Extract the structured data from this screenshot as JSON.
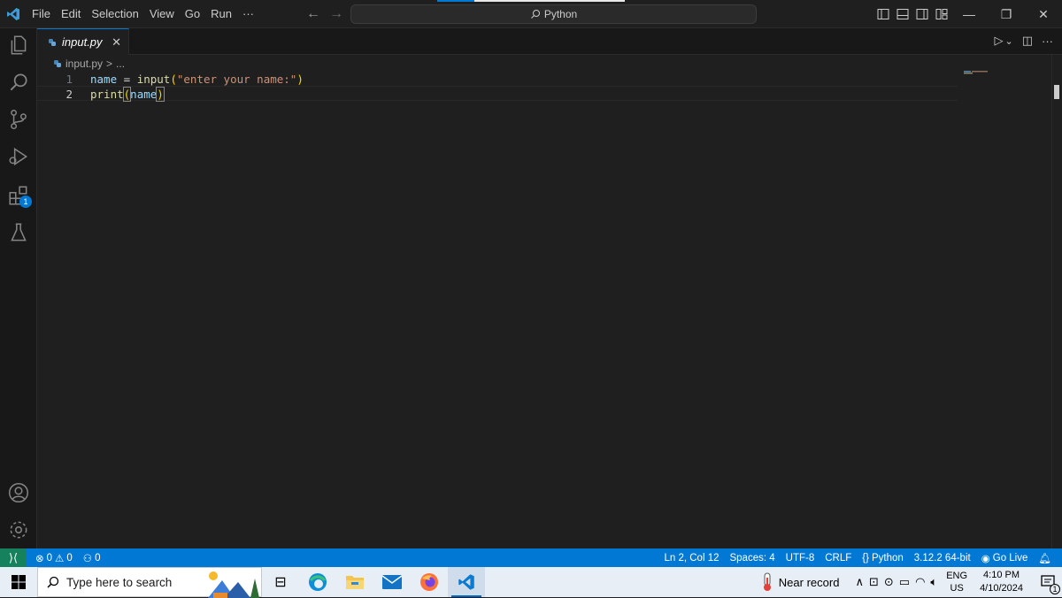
{
  "titlebar": {
    "menu": [
      "File",
      "Edit",
      "Selection",
      "View",
      "Go",
      "Run",
      "···"
    ],
    "command_center": "Python",
    "window_controls": {
      "minimize": "—",
      "restore": "❐",
      "close": "✕"
    }
  },
  "activity_bar": {
    "items": [
      "explorer-icon",
      "search-icon",
      "source-control-icon",
      "run-debug-icon",
      "extensions-icon",
      "testing-icon"
    ],
    "extensions_badge": "1",
    "bottom": [
      "accounts-icon",
      "manage-gear-icon"
    ]
  },
  "tabs": [
    {
      "label": "input.py",
      "close": "✕"
    }
  ],
  "editor_actions": {
    "run": "▷",
    "dropdown": "⌄",
    "split": "◫",
    "more": "···"
  },
  "breadcrumb": {
    "file": "input.py",
    "separator": ">",
    "rest": "..."
  },
  "editor": {
    "lines": [
      {
        "number": "1",
        "tokens": [
          {
            "text": "name",
            "type": "var"
          },
          {
            "text": " = ",
            "type": "op"
          },
          {
            "text": "input",
            "type": "fn"
          },
          {
            "text": "(",
            "type": "par"
          },
          {
            "text": "\"enter your name:\"",
            "type": "str"
          },
          {
            "text": ")",
            "type": "par"
          }
        ]
      },
      {
        "number": "2",
        "tokens": [
          {
            "text": "print",
            "type": "fn"
          },
          {
            "text": "(",
            "type": "par"
          },
          {
            "text": "name",
            "type": "var"
          },
          {
            "text": ")",
            "type": "par"
          }
        ]
      }
    ]
  },
  "statusbar": {
    "errors": "0",
    "warnings": "0",
    "ports": "0",
    "cursor": "Ln 2, Col 12",
    "spaces": "Spaces: 4",
    "encoding": "UTF-8",
    "eol": "CRLF",
    "language": "Python",
    "interpreter": "3.12.2 64-bit",
    "go_live": "Go Live"
  },
  "taskbar": {
    "search_placeholder": "Type here to search",
    "weather": "Near record",
    "language": {
      "line1": "ENG",
      "line2": "US"
    },
    "time": "4:10 PM",
    "date": "4/10/2024",
    "notification_count": "1"
  },
  "colors": {
    "accent": "#0078d4",
    "remote": "#16825d",
    "editor_bg": "#1f1f1f"
  }
}
